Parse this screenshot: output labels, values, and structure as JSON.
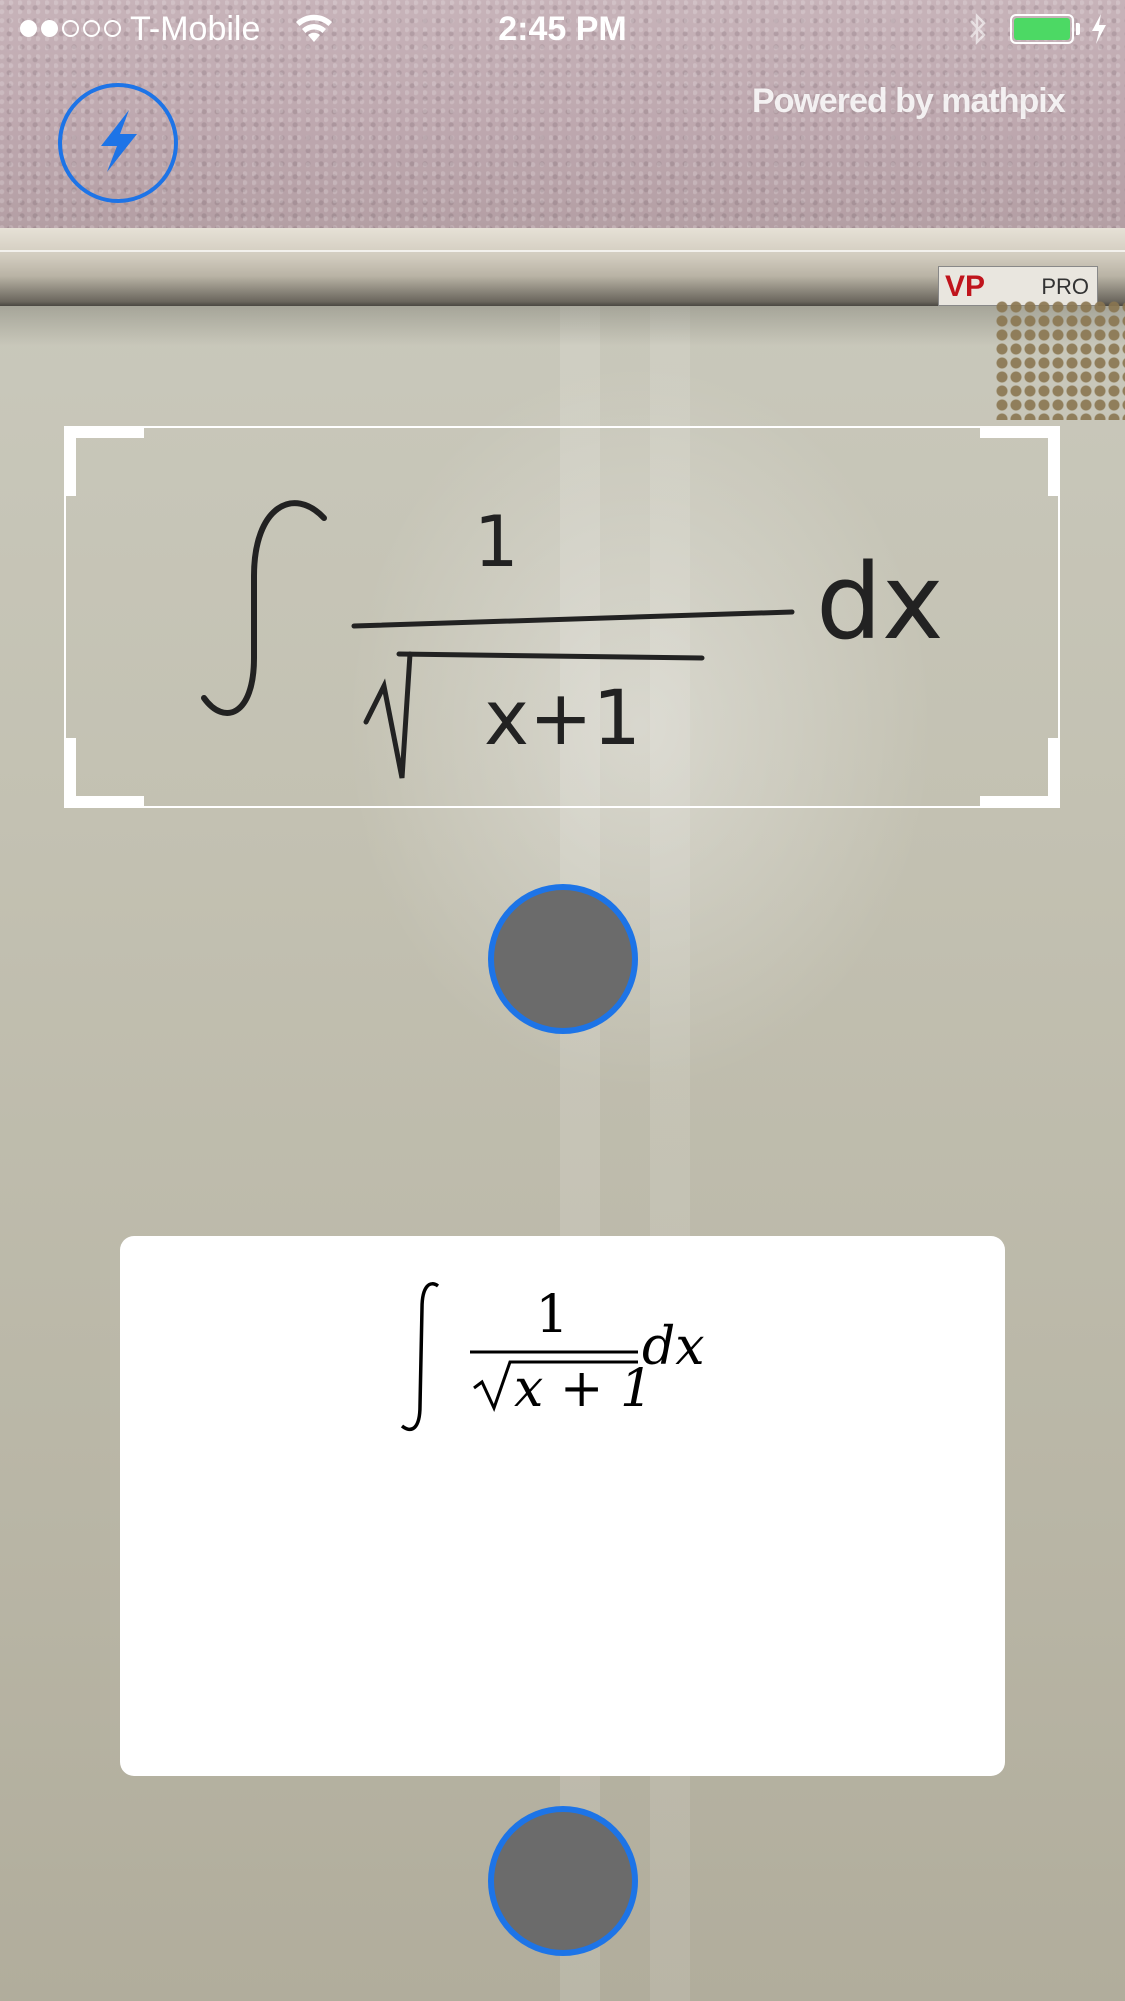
{
  "status_bar": {
    "signal_bars_filled": 2,
    "signal_bars_total": 5,
    "carrier": "T-Mobile",
    "time": "2:45 PM",
    "battery_level": 1.0,
    "battery_color": "#4cd964"
  },
  "header": {
    "powered_by": "Powered by mathpix"
  },
  "camera_scene": {
    "marker_label": "PRO",
    "marker_brand": "VP",
    "handwritten_numerator": "1",
    "handwritten_radicand": "x+1",
    "handwritten_differential": "dx"
  },
  "result": {
    "numerator": "1",
    "radicand": "x + 1",
    "differential": "dx"
  },
  "colors": {
    "accent": "#1d74e7",
    "button_fill": "#6b6b6b",
    "card_background": "#ffffff"
  },
  "icons": {
    "flash": "flash-icon",
    "wifi": "wifi-icon",
    "bluetooth": "bluetooth-icon",
    "charging": "charging-icon"
  }
}
